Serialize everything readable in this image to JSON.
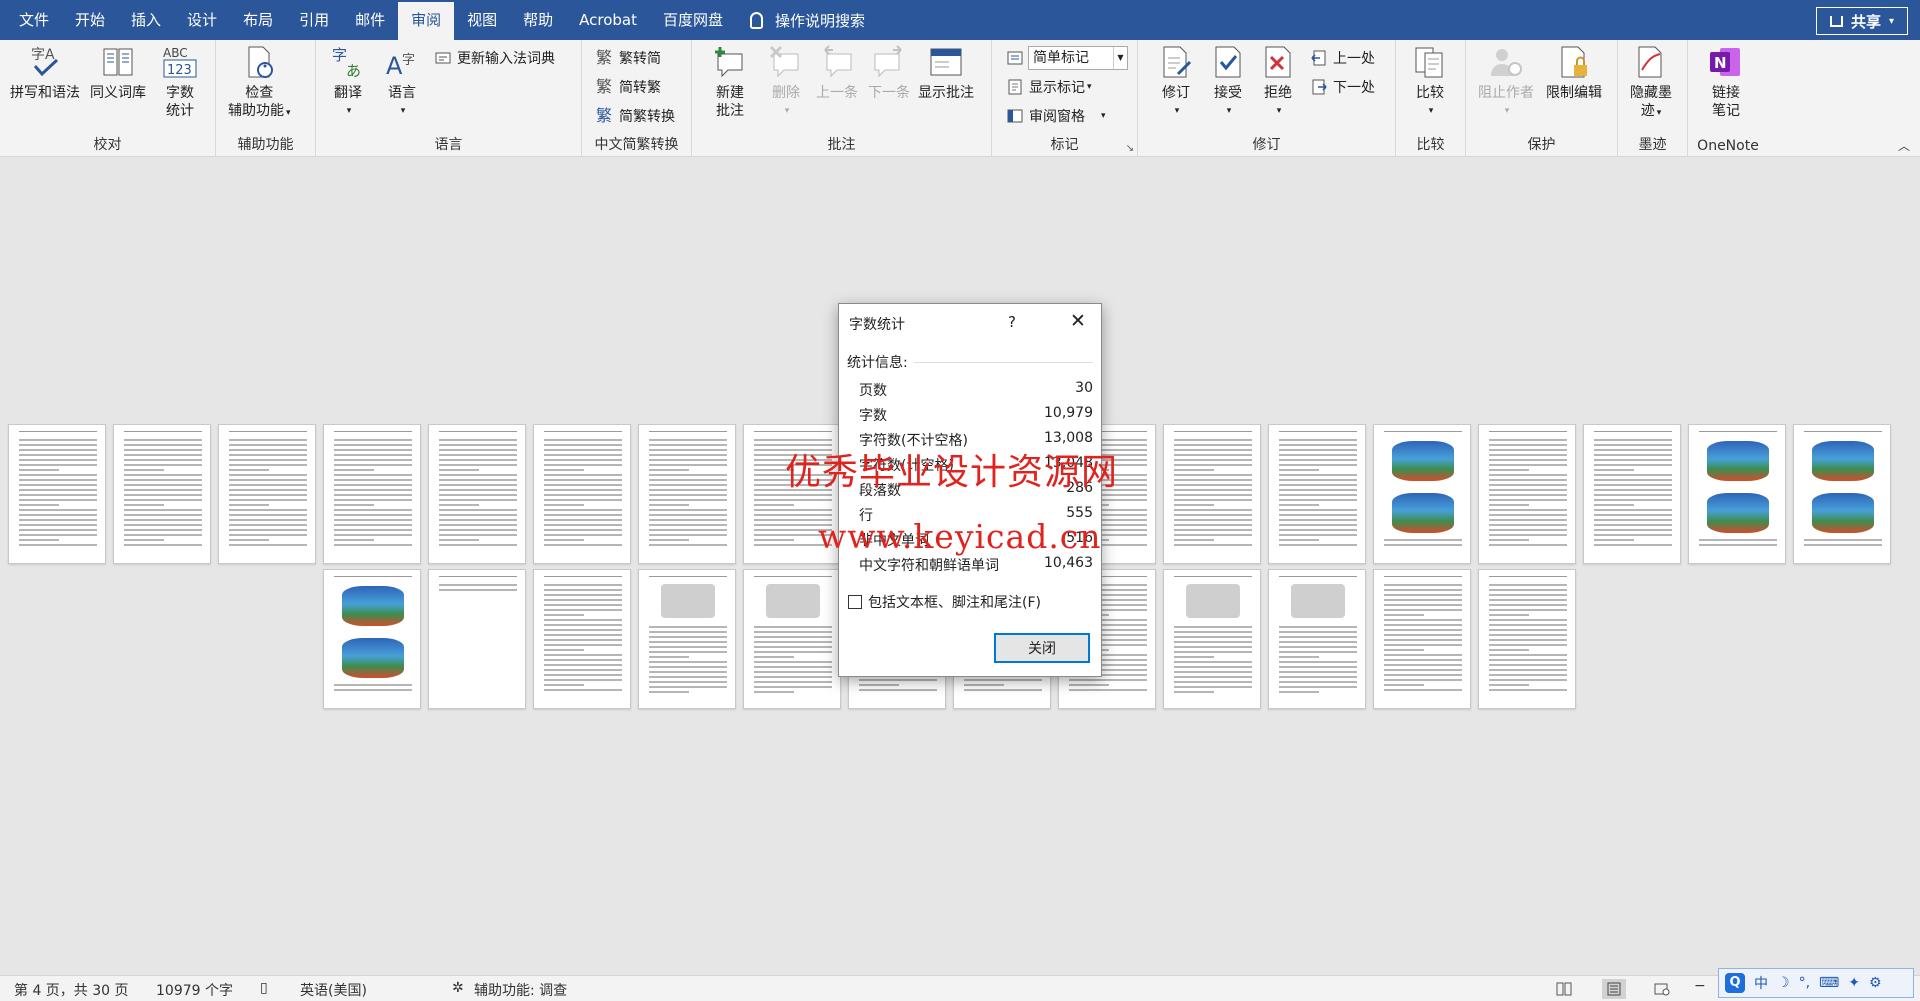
{
  "menu": {
    "tabs": [
      "文件",
      "开始",
      "插入",
      "设计",
      "布局",
      "引用",
      "邮件",
      "审阅",
      "视图",
      "帮助",
      "Acrobat",
      "百度网盘"
    ],
    "active_tab": "审阅",
    "tell_me": "操作说明搜索",
    "share": "共享"
  },
  "ribbon": {
    "proofing": {
      "label": "校对",
      "spelling": "拼写和语法",
      "thesaurus": "同义词库",
      "word_count_line1": "字数",
      "word_count_line2": "统计",
      "abc_icon": "ABC",
      "num_icon": "123"
    },
    "accessibility": {
      "label": "辅助功能",
      "check_line1": "检查",
      "check_line2": "辅助功能"
    },
    "language": {
      "label": "语言",
      "translate": "翻译",
      "language": "语言",
      "update_ime": "更新输入法词典"
    },
    "chinese_conversion": {
      "label": "中文简繁转换",
      "to_simplified": "繁转简",
      "to_traditional": "简转繁",
      "convert": "简繁转换"
    },
    "comments": {
      "label": "批注",
      "new_line1": "新建",
      "new_line2": "批注",
      "delete": "删除",
      "previous": "上一条",
      "next": "下一条",
      "show": "显示批注"
    },
    "tracking": {
      "label": "标记",
      "markup_select": "简单标记",
      "show_markup": "显示标记",
      "reviewing_pane": "审阅窗格"
    },
    "changes": {
      "label": "修订",
      "track": "修订",
      "accept": "接受",
      "reject": "拒绝",
      "previous": "上一处",
      "next": "下一处"
    },
    "compare": {
      "label": "比较",
      "compare": "比较"
    },
    "protect": {
      "label": "保护",
      "block_authors": "阻止作者",
      "restrict": "限制编辑"
    },
    "ink": {
      "label": "墨迹",
      "hide_ink_line1": "隐藏墨",
      "hide_ink_line2": "迹"
    },
    "onenote": {
      "label": "OneNote",
      "linked_notes_line1": "链接",
      "linked_notes_line2": "笔记",
      "icon_letter": "N"
    }
  },
  "dialog": {
    "title": "字数统计",
    "help": "?",
    "section": "统计信息:",
    "stats": [
      {
        "label": "页数",
        "value": "30"
      },
      {
        "label": "字数",
        "value": "10,979"
      },
      {
        "label": "字符数(不计空格)",
        "value": "13,008"
      },
      {
        "label": "字符数(计空格)",
        "value": "13,048"
      },
      {
        "label": "段落数",
        "value": "286"
      },
      {
        "label": "行",
        "value": "555"
      },
      {
        "label": "非中文单词",
        "value": "516"
      },
      {
        "label": "中文字符和朝鲜语单词",
        "value": "10,463"
      }
    ],
    "include_textboxes": "包括文本框、脚注和尾注(F)",
    "close_button": "关闭"
  },
  "watermark": {
    "line1": "优秀毕业设计资源网",
    "line2": "www.keyicad.cn"
  },
  "statusbar": {
    "page_info": "第 4 页，共 30 页",
    "word_count": "10979 个字",
    "language": "英语(美国)",
    "accessibility": "辅助功能: 调查"
  },
  "ime": {
    "logo": "Q",
    "mode": "中",
    "moon": "☽",
    "punct": "°,",
    "keyboard": "⌨",
    "tool": "✦",
    "wrench": "⚙"
  },
  "document": {
    "page_count": 30
  }
}
